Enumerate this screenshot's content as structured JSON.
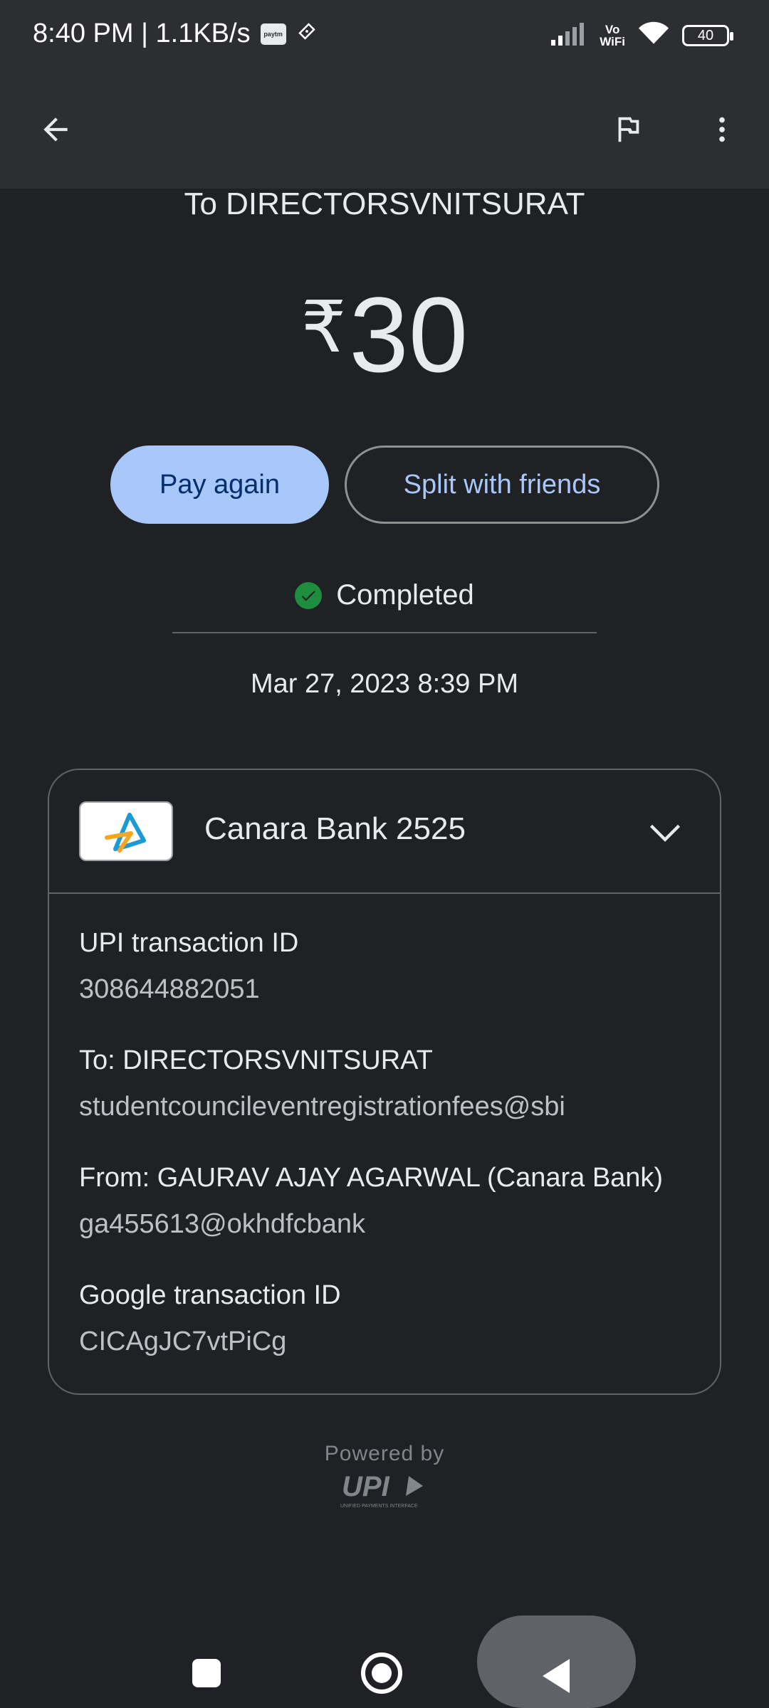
{
  "status_bar": {
    "time_speed": "8:40 PM | 1.1KB/s",
    "paytm_badge": "paytm",
    "vowifi_top": "Vo",
    "vowifi_bottom": "WiFi",
    "battery": "40"
  },
  "app_bar": {
    "back_icon": "arrow-left-icon",
    "flag_icon": "flag-icon",
    "more_icon": "more-vertical-icon"
  },
  "transaction": {
    "payee_heading": "To DIRECTORSVNITSURAT",
    "currency_symbol": "₹",
    "amount": "30",
    "status": "Completed",
    "date_time": "Mar 27, 2023 8:39 PM"
  },
  "actions": {
    "pay_again": "Pay again",
    "split": "Split with friends"
  },
  "details_card": {
    "bank_name": "Canara Bank 2525",
    "upi_id_label": "UPI transaction ID",
    "upi_id_value": "308644882051",
    "to_label": "To: DIRECTORSVNITSURAT",
    "to_value": "studentcouncileventregistrationfees@sbi",
    "from_label": "From: GAURAV AJAY AGARWAL (Canara Bank)",
    "from_value": "ga455613@okhdfcbank",
    "google_id_label": "Google transaction ID",
    "google_id_value": "CICAgJC7vtPiCg"
  },
  "footer": {
    "powered_by": "Powered by",
    "upi_text": "UPI",
    "upi_subtext": "UNIFIED PAYMENTS INTERFACE"
  },
  "colors": {
    "background": "#202124",
    "app_bar": "#2d2e31",
    "primary_button": "#a8c7fa",
    "success": "#1e8e3e"
  }
}
